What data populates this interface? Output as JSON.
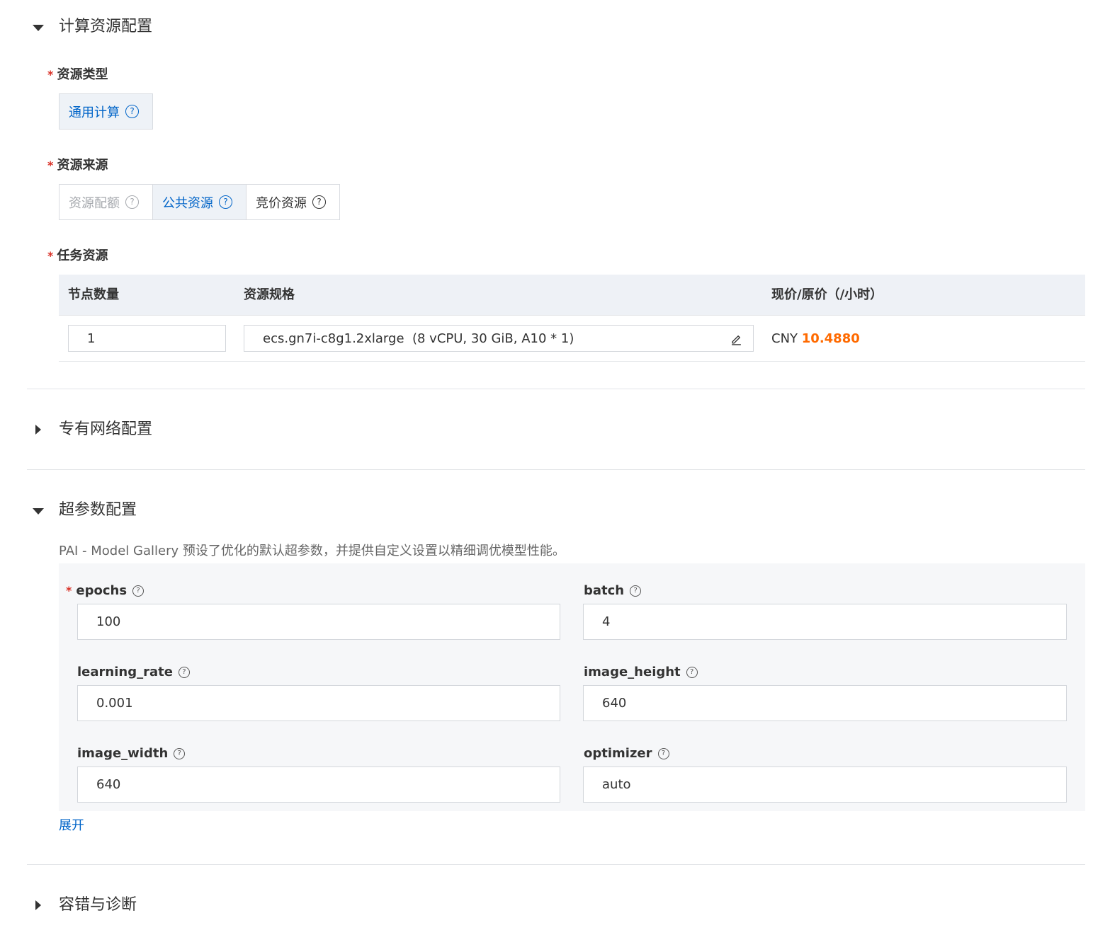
{
  "compute_section": {
    "title": "计算资源配置",
    "resource_type": {
      "label": "资源类型",
      "options": [
        {
          "label": "通用计算"
        }
      ]
    },
    "resource_source": {
      "label": "资源来源",
      "options": [
        {
          "label": "资源配额",
          "state": "disabled"
        },
        {
          "label": "公共资源",
          "state": "selected"
        },
        {
          "label": "竞价资源",
          "state": "normal"
        }
      ]
    },
    "task_resource": {
      "label": "任务资源",
      "columns": [
        "节点数量",
        "资源规格",
        "现价/原价（/小时）"
      ],
      "row": {
        "node_count": "1",
        "spec": "ecs.gn7i-c8g1.2xlarge  (8 vCPU, 30 GiB, A10 * 1)",
        "price_currency": "CNY",
        "price_value": "10.4880"
      }
    }
  },
  "vpc_section": {
    "title": "专有网络配置"
  },
  "hyper_section": {
    "title": "超参数配置",
    "description": "PAI - Model Gallery 预设了优化的默认超参数，并提供自定义设置以精细调优模型性能。",
    "params": [
      {
        "name": "epochs",
        "value": "100"
      },
      {
        "name": "batch",
        "value": "4"
      },
      {
        "name": "learning_rate",
        "value": "0.001"
      },
      {
        "name": "image_height",
        "value": "640"
      },
      {
        "name": "image_width",
        "value": "640"
      },
      {
        "name": "optimizer",
        "value": "auto"
      }
    ],
    "expand_link": "展开"
  },
  "fault_section": {
    "title": "容错与诊断"
  },
  "colors": {
    "accent": "#0064c8",
    "price": "#ff6a00",
    "required": "#d93026",
    "panel_bg": "#f6f7f9"
  },
  "icons": {
    "collapse": "caret-down-icon",
    "expand": "caret-right-icon",
    "help": "question-circle-icon",
    "edit": "edit-pencil-icon"
  }
}
